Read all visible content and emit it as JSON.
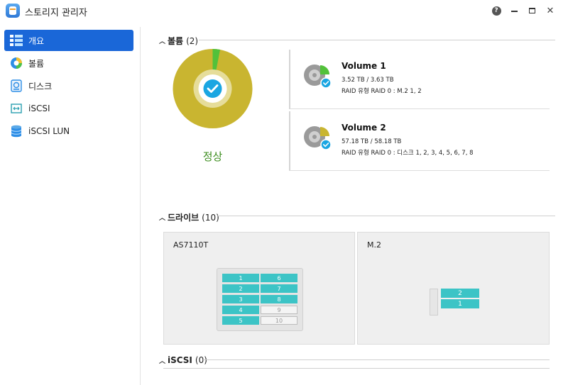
{
  "window": {
    "title": "스토리지 관리자"
  },
  "sidebar": {
    "items": [
      {
        "label": "개요",
        "icon": "overview-icon",
        "active": true
      },
      {
        "label": "볼륨",
        "icon": "volume-icon"
      },
      {
        "label": "디스크",
        "icon": "disk-icon"
      },
      {
        "label": "iSCSI",
        "icon": "iscsi-icon"
      },
      {
        "label": "iSCSI LUN",
        "icon": "iscsi-lun-icon"
      }
    ]
  },
  "volumes_section": {
    "title": "볼륨",
    "count": "(2)",
    "status": "정상",
    "donut": {
      "used_fraction": 0.97,
      "free_fraction": 0.03,
      "used_color": "#c9b530",
      "free_color": "#52c13a",
      "check_color": "#1aa6e2"
    },
    "volumes": [
      {
        "name": "Volume 1",
        "size": "3.52 TB / 3.63 TB",
        "raid": "RAID 유형 RAID 0 : M.2 1, 2",
        "used_fraction": 0.97,
        "accent": "#52c13a"
      },
      {
        "name": "Volume 2",
        "size": "57.18 TB / 58.18 TB",
        "raid": "RAID 유형 RAID 0 : 디스크 1, 2, 3, 4, 5, 6, 7, 8",
        "used_fraction": 0.98,
        "accent": "#c9b530"
      }
    ]
  },
  "drives_section": {
    "title": "드라이브",
    "count": "(10)",
    "enclosures": [
      {
        "name": "AS7110T",
        "bays": [
          {
            "label": "1",
            "populated": true
          },
          {
            "label": "2",
            "populated": true
          },
          {
            "label": "3",
            "populated": true
          },
          {
            "label": "4",
            "populated": true
          },
          {
            "label": "5",
            "populated": true
          },
          {
            "label": "6",
            "populated": true
          },
          {
            "label": "7",
            "populated": true
          },
          {
            "label": "8",
            "populated": true
          },
          {
            "label": "9",
            "populated": false
          },
          {
            "label": "10",
            "populated": false
          }
        ]
      },
      {
        "name": "M.2",
        "slots": [
          {
            "label": "2",
            "populated": true
          },
          {
            "label": "1",
            "populated": true
          }
        ]
      }
    ]
  },
  "iscsi_section": {
    "title": "iSCSI",
    "count": "(0)"
  }
}
